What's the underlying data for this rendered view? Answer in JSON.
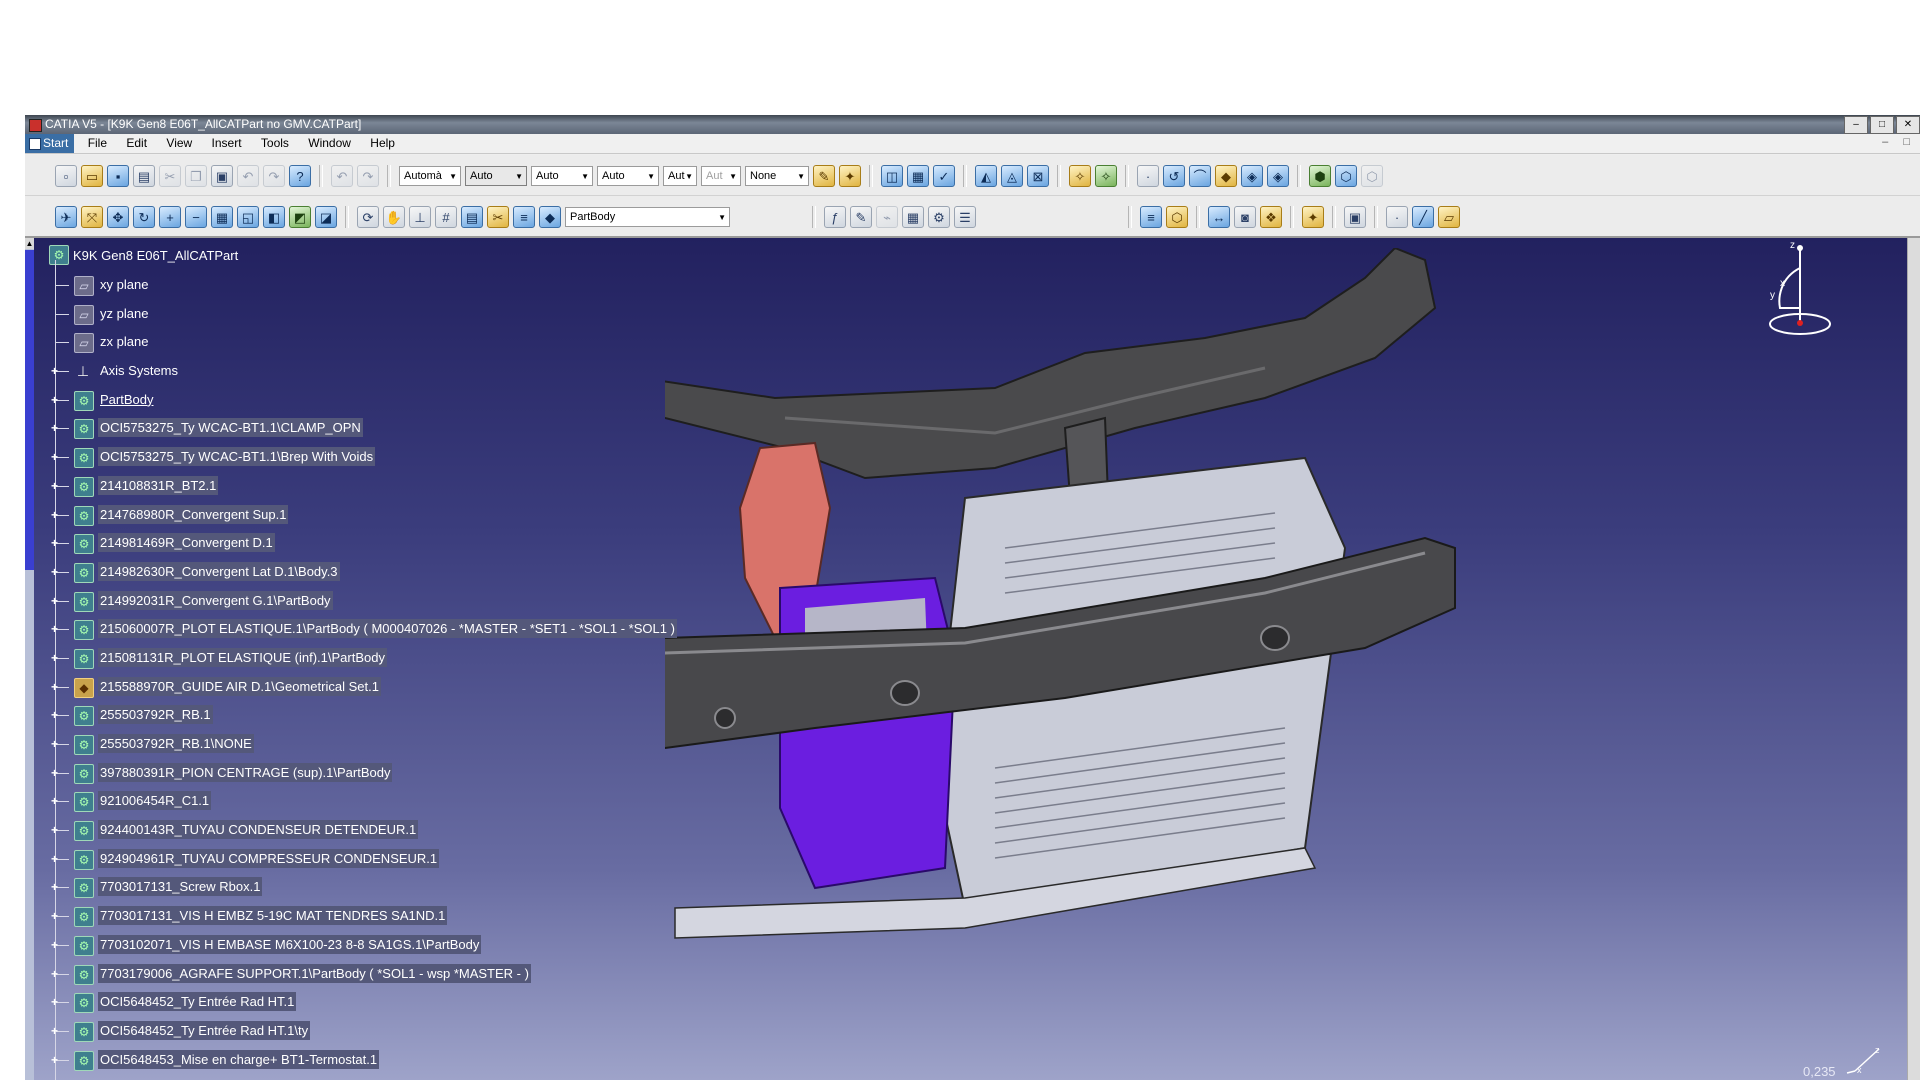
{
  "window": {
    "title": "CATIA V5 - [K9K Gen8 E06T_AllCATPart no GMV.CATPart]",
    "controls": [
      "–",
      "□",
      "✕"
    ]
  },
  "menubar": {
    "items": [
      "Start",
      "File",
      "Edit",
      "View",
      "Insert",
      "Tools",
      "Window",
      "Help"
    ],
    "doc_controls": "– □"
  },
  "toolbar": {
    "combo_1": "Automà",
    "combo_2": "Auto",
    "combo_3": "Auto",
    "combo_4": "Auto",
    "combo_5": "Aut",
    "combo_6": "Aut",
    "combo_7": "None",
    "current_body": "PartBody",
    "icons_row1": [
      "new-icon",
      "open-icon",
      "save-icon",
      "print-icon",
      "cut-icon",
      "copy-icon",
      "paste-icon",
      "undo-icon",
      "redo-icon",
      "whats-this-icon",
      "undo-history-icon",
      "redo-history-icon",
      "plane-icon",
      "point-icon",
      "line-icon",
      "circle-icon",
      "curve-icon",
      "surface-icon",
      "sketch-icon",
      "analysis-icon",
      "knowledge-icon",
      "catalog-icon",
      "apply-material-icon"
    ],
    "icons_row2": [
      "fly-mode-icon",
      "fit-all-icon",
      "pan-icon",
      "rotate-icon",
      "zoom-in-icon",
      "zoom-out-icon",
      "normal-view-icon",
      "iso-view-icon",
      "shading-icon",
      "hide-show-icon",
      "swap-space-icon",
      "render-icon",
      "update-icon",
      "measure-icon",
      "axis-icon",
      "number-icon",
      "table-icon",
      "formula-icon",
      "comment-icon",
      "grid-icon",
      "parameter-icon",
      "list-icon",
      "publish-icon"
    ]
  },
  "tree": {
    "root": "K9K Gen8 E06T_AllCATPart",
    "items": [
      {
        "label": "xy plane",
        "icon": "plane",
        "expand": false,
        "highlight": false
      },
      {
        "label": "yz plane",
        "icon": "plane",
        "expand": false,
        "highlight": false
      },
      {
        "label": "zx plane",
        "icon": "plane",
        "expand": false,
        "highlight": false
      },
      {
        "label": "Axis Systems",
        "icon": "axis",
        "expand": true,
        "highlight": false
      },
      {
        "label": "PartBody",
        "icon": "body",
        "expand": true,
        "highlight": false,
        "underline": true
      },
      {
        "label": "OCI5753275_Ty WCAC-BT1.1\\CLAMP_OPN",
        "icon": "body",
        "expand": true,
        "highlight": true
      },
      {
        "label": "OCI5753275_Ty WCAC-BT1.1\\Brep With Voids",
        "icon": "body",
        "expand": true,
        "highlight": true
      },
      {
        "label": "214108831R_BT2.1",
        "icon": "body",
        "expand": true,
        "highlight": true
      },
      {
        "label": "214768980R_Convergent Sup.1",
        "icon": "body",
        "expand": true,
        "highlight": true
      },
      {
        "label": "214981469R_Convergent D.1",
        "icon": "body",
        "expand": true,
        "highlight": true
      },
      {
        "label": "214982630R_Convergent Lat D.1\\Body.3",
        "icon": "body",
        "expand": true,
        "highlight": true
      },
      {
        "label": "214992031R_Convergent G.1\\PartBody",
        "icon": "body",
        "expand": true,
        "highlight": true
      },
      {
        "label": "215060007R_PLOT ELASTIQUE.1\\PartBody ( M000407026 - *MASTER - *SET1 - *SOL1 - *SOL1 )",
        "icon": "body",
        "expand": true,
        "highlight": true
      },
      {
        "label": "215081131R_PLOT ELASTIQUE (inf).1\\PartBody",
        "icon": "body",
        "expand": true,
        "highlight": true
      },
      {
        "label": "215588970R_GUIDE AIR D.1\\Geometrical Set.1",
        "icon": "geom",
        "expand": true,
        "highlight": true
      },
      {
        "label": "255503792R_RB.1",
        "icon": "body",
        "expand": true,
        "highlight": true
      },
      {
        "label": "255503792R_RB.1\\NONE",
        "icon": "body",
        "expand": true,
        "highlight": true
      },
      {
        "label": "397880391R_PION CENTRAGE (sup).1\\PartBody",
        "icon": "body",
        "expand": true,
        "highlight": true
      },
      {
        "label": "921006454R_C1.1",
        "icon": "body",
        "expand": true,
        "highlight": true
      },
      {
        "label": "924400143R_TUYAU CONDENSEUR DETENDEUR.1",
        "icon": "body",
        "expand": true,
        "highlight": true
      },
      {
        "label": "924904961R_TUYAU COMPRESSEUR CONDENSEUR.1",
        "icon": "body",
        "expand": true,
        "highlight": true
      },
      {
        "label": "7703017131_Screw  Rbox.1",
        "icon": "body",
        "expand": true,
        "highlight": true
      },
      {
        "label": "7703017131_VIS H EMBZ 5-19C MAT TENDRES SA1ND.1",
        "icon": "body",
        "expand": true,
        "highlight": true
      },
      {
        "label": "7703102071_VIS H EMBASE M6X100-23 8-8 SA1GS.1\\PartBody",
        "icon": "body",
        "expand": true,
        "highlight": true
      },
      {
        "label": "7703179006_AGRAFE SUPPORT.1\\PartBody ( *SOL1 - wsp *MASTER -  )",
        "icon": "body",
        "expand": true,
        "highlight": true
      },
      {
        "label": "OCI5648452_Ty Entrée Rad HT.1",
        "icon": "body",
        "expand": true,
        "highlight": true
      },
      {
        "label": "OCI5648452_Ty Entrée Rad HT.1\\ty",
        "icon": "body",
        "expand": true,
        "highlight": true
      },
      {
        "label": "OCI5648453_Mise en charge+ BT1-Termostat.1",
        "icon": "body",
        "expand": true,
        "highlight": true
      }
    ]
  },
  "compass": {
    "x": "x",
    "y": "y",
    "z": "z"
  },
  "status": {
    "zoom": "0,235"
  },
  "colors": {
    "viewport_top": "#22215f",
    "viewport_bottom": "#9ea3c9",
    "part_dark": "#4a4a4a",
    "part_red": "#d9736a",
    "part_purple": "#6b1ee0",
    "part_light": "#c9ccd8"
  }
}
